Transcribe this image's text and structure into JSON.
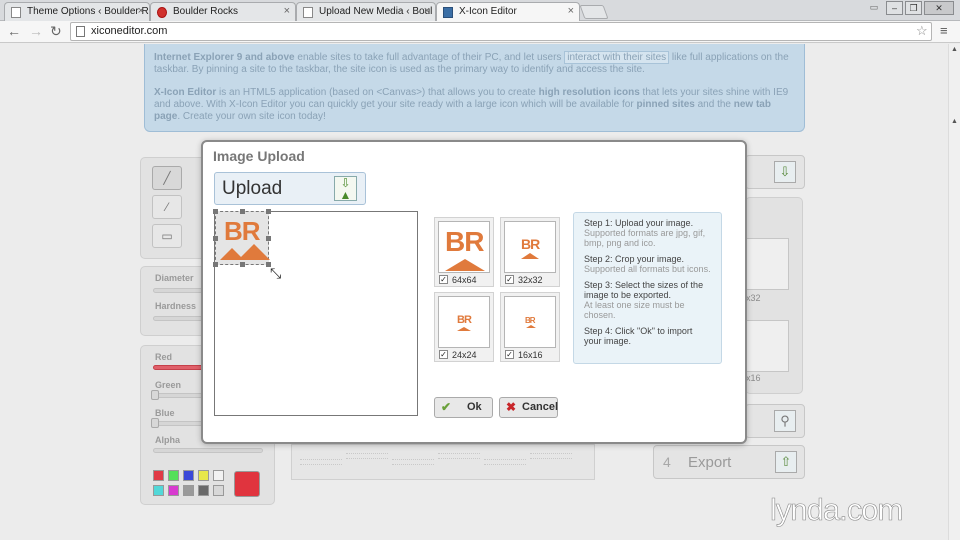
{
  "browser": {
    "tabs": [
      {
        "title": "Theme Options ‹ Boulder R",
        "close": "×"
      },
      {
        "title": "Boulder Rocks",
        "close": "×"
      },
      {
        "title": "Upload New Media ‹ Boul",
        "close": "×"
      },
      {
        "title": "X-Icon Editor",
        "close": "×"
      }
    ],
    "url": "xiconeditor.com",
    "back": "←",
    "forward": "→",
    "reload": "↻",
    "star": "☆",
    "menu": "≡",
    "window_buttons": {
      "minimize": "–",
      "maximize": "❐",
      "close": "✕"
    }
  },
  "intro": {
    "para1_lead": "Internet Explorer 9 and above",
    "para1_mid": " enable sites to take full advantage of their PC, and let users ",
    "para1_hl": "interact with their sites",
    "para1_tail": " like full applications on the taskbar. By pinning a site to the taskbar, the site icon is used as the primary way to identify and access the site.",
    "para2_lead": "X-Icon Editor",
    "para2_a": " is an HTML5 application (based on <Canvas>) that allows you to create ",
    "para2_b": "high resolution icons",
    "para2_c": " that lets your sites shine with IE9 and above. With X-Icon Editor you can quickly get your site ready with a large icon which will be available for ",
    "para2_d": "pinned sites",
    "para2_e": " and the ",
    "para2_f": "new tab page",
    "para2_g": ". Create your own site icon today!"
  },
  "tools": {
    "diameter": "Diameter",
    "hardness": "Hardness",
    "red": "Red",
    "green": "Green",
    "blue": "Blue",
    "alpha": "Alpha",
    "swatches": [
      "#e03a46",
      "#54e05a",
      "#3a48d8",
      "#e8e84a",
      "#f2f2f2",
      "#52d8d8",
      "#d83ad0",
      "#9a9a9a",
      "#6a6a6a",
      "#d8d8d8"
    ],
    "current_color": "#e0343e"
  },
  "right": {
    "size_32": "x32",
    "size_16": "x16",
    "export_num": "4",
    "export_label": "Export"
  },
  "dialog": {
    "title": "Image Upload",
    "upload_label": "Upload",
    "logo_text": "BR",
    "sizes": [
      {
        "label": "64x64",
        "checked": "✓"
      },
      {
        "label": "32x32",
        "checked": "✓"
      },
      {
        "label": "24x24",
        "checked": "✓"
      },
      {
        "label": "16x16",
        "checked": "✓"
      }
    ],
    "steps": [
      {
        "main": "Step 1: Upload your image.",
        "sub": "Supported formats are jpg, gif, bmp, png and ico."
      },
      {
        "main": "Step 2: Crop your image.",
        "sub": "Supported all formats but icons."
      },
      {
        "main": "Step 3: Select the sizes of the image to be exported.",
        "sub": "At least one size must be chosen."
      },
      {
        "main": "Step 4: Click \"Ok\" to import your image.",
        "sub": ""
      }
    ],
    "ok_label": "Ok",
    "cancel_label": "Cancel"
  },
  "watermark": "lynda.com",
  "colors": {
    "accent_orange": "#e07a3c",
    "info_bg": "#c5d9e8"
  }
}
